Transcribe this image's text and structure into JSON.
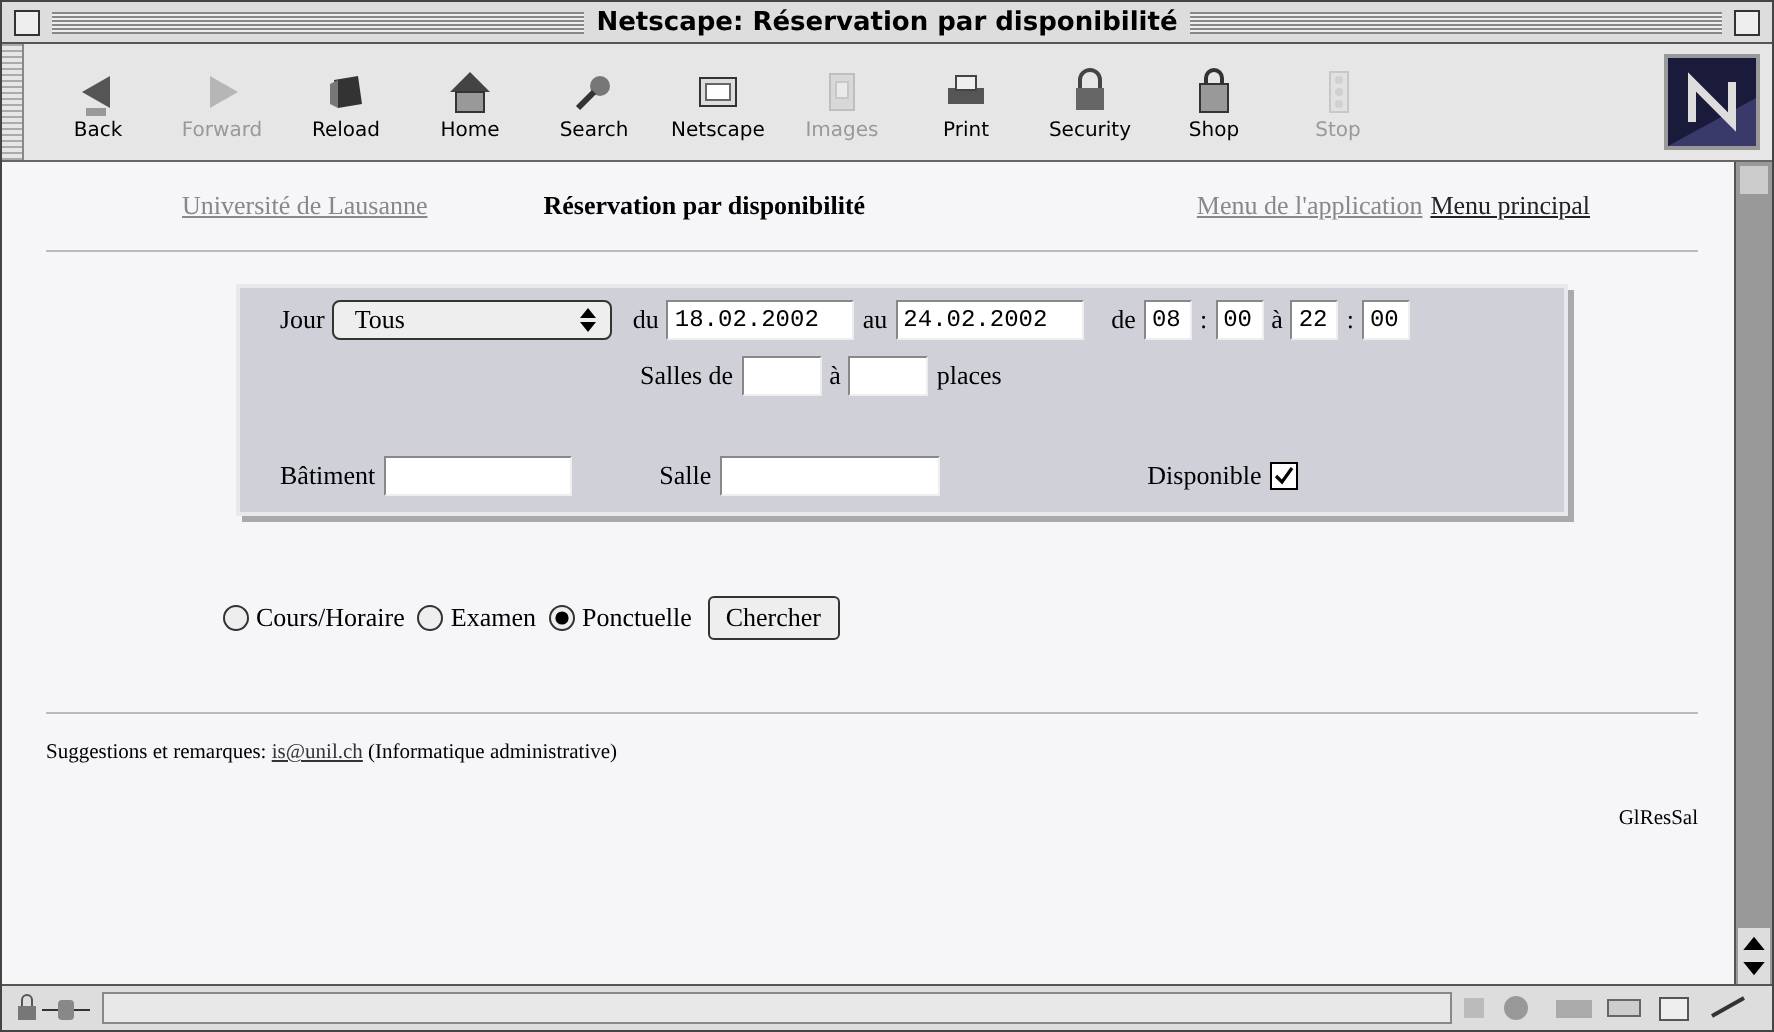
{
  "window": {
    "title": "Netscape: Réservation par disponibilité"
  },
  "toolbar": [
    {
      "label": "Back",
      "disabled": false
    },
    {
      "label": "Forward",
      "disabled": true
    },
    {
      "label": "Reload",
      "disabled": false
    },
    {
      "label": "Home",
      "disabled": false
    },
    {
      "label": "Search",
      "disabled": false
    },
    {
      "label": "Netscape",
      "disabled": false
    },
    {
      "label": "Images",
      "disabled": true
    },
    {
      "label": "Print",
      "disabled": false
    },
    {
      "label": "Security",
      "disabled": false
    },
    {
      "label": "Shop",
      "disabled": false
    },
    {
      "label": "Stop",
      "disabled": true
    }
  ],
  "header": {
    "left_link": "Université de Lausanne",
    "title": "Réservation par disponibilité",
    "links": [
      {
        "label": "Menu de l'application",
        "visited": true
      },
      {
        "label": "Menu principal",
        "visited": false
      }
    ]
  },
  "form": {
    "jour_label": "Jour",
    "jour_value": "Tous",
    "du_label": "du",
    "du_value": "18.02.2002",
    "au_label": "au",
    "au_value": "24.02.2002",
    "de_label": "de",
    "from_hour": "08",
    "sep1": ":",
    "from_min": "00",
    "a_label": "à",
    "to_hour": "22",
    "sep2": ":",
    "to_min": "00",
    "salles_label": "Salles de",
    "salles_a": "à",
    "places_label": "places",
    "batiment_label": "Bâtiment",
    "salle_label": "Salle",
    "disponible_label": "Disponible",
    "disponible_checked": true
  },
  "modes": [
    {
      "label": "Cours/Horaire",
      "selected": false
    },
    {
      "label": "Examen",
      "selected": false
    },
    {
      "label": "Ponctuelle",
      "selected": true
    }
  ],
  "search_button": "Chercher",
  "footer": {
    "prefix": "Suggestions et remarques:",
    "email": "is@unil.ch",
    "suffix": "(Informatique administrative)",
    "code": "GlResSal"
  }
}
